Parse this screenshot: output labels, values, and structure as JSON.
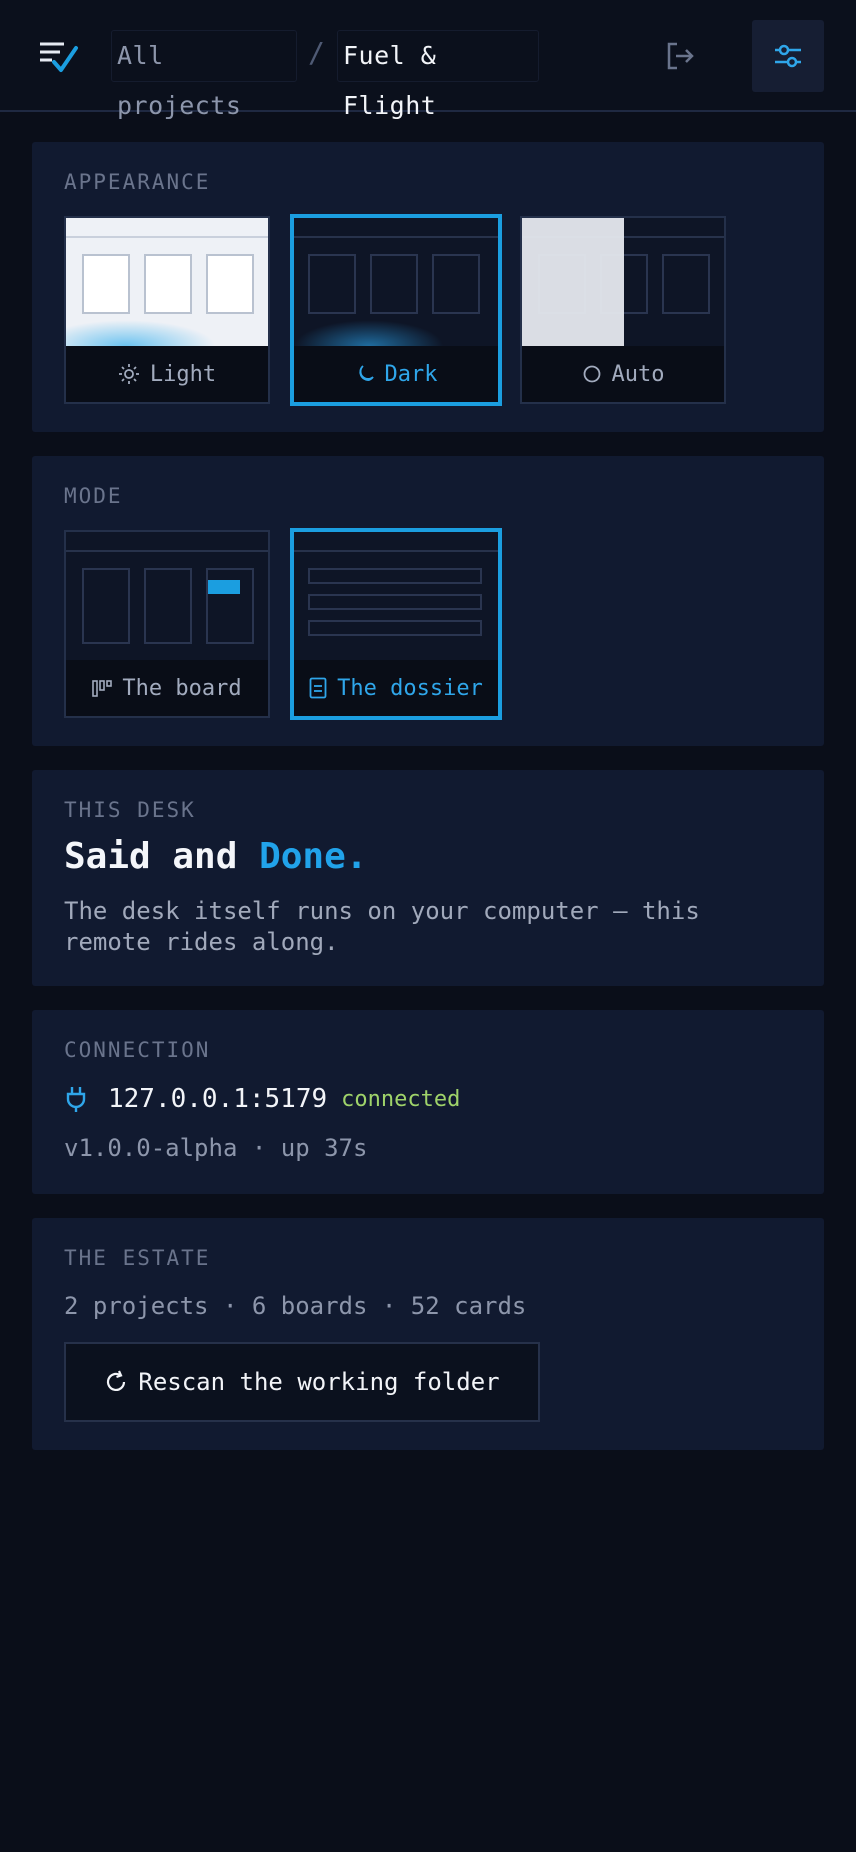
{
  "breadcrumb": {
    "root": "All projects",
    "separator": "/",
    "current": "Fuel & Flight"
  },
  "icons": {
    "logo": "checklist-icon",
    "logout": "logout-icon",
    "settings": "sliders-icon"
  },
  "appearance": {
    "title": "APPEARANCE",
    "options": [
      {
        "label": "Light",
        "icon": "sun-icon",
        "selected": false
      },
      {
        "label": "Dark",
        "icon": "moon-icon",
        "selected": true
      },
      {
        "label": "Auto",
        "icon": "circle-icon",
        "selected": false
      }
    ]
  },
  "mode": {
    "title": "MODE",
    "options": [
      {
        "label": "The board",
        "icon": "kanban-icon",
        "selected": false
      },
      {
        "label": "The dossier",
        "icon": "document-icon",
        "selected": true
      }
    ]
  },
  "desk": {
    "title": "THIS DESK",
    "heading_main": "Said and",
    "heading_accent": "Done.",
    "description": "The desk itself runs on your computer — this remote rides along."
  },
  "connection": {
    "title": "CONNECTION",
    "address": "127.0.0.1:5179",
    "status": "connected",
    "version": "v1.0.0-alpha · up 37s"
  },
  "estate": {
    "title": "THE ESTATE",
    "summary": "2 projects · 6 boards · 52 cards",
    "rescan_label": "Rescan the working folder"
  },
  "colors": {
    "accent": "#1b9ee0",
    "success": "#9fd36a",
    "background": "#0a0e19",
    "panel": "#111a30"
  }
}
